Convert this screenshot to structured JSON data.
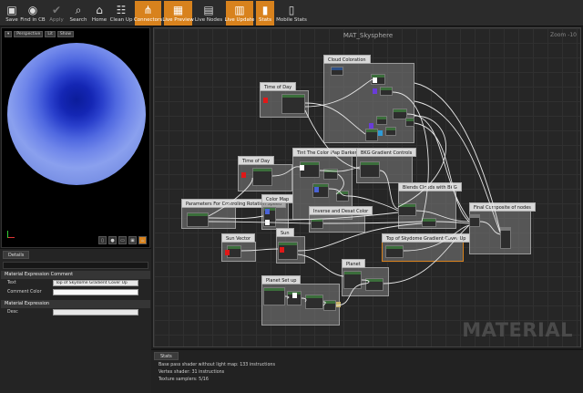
{
  "toolbar": {
    "buttons": [
      {
        "label": "Save",
        "icon": "save-icon"
      },
      {
        "label": "Find in CB",
        "icon": "find-icon"
      },
      {
        "label": "Apply",
        "icon": "apply-icon"
      },
      {
        "label": "Search",
        "icon": "search-icon"
      },
      {
        "label": "Home",
        "icon": "home-icon"
      },
      {
        "label": "Clean Up",
        "icon": "clean-up-icon"
      },
      {
        "label": "Connectors",
        "icon": "connectors-icon"
      },
      {
        "label": "Live Preview",
        "icon": "live-preview-icon"
      },
      {
        "label": "Live Nodes",
        "icon": "live-nodes-icon"
      },
      {
        "label": "Live Update",
        "icon": "live-update-icon"
      },
      {
        "label": "Stats",
        "icon": "stats-icon"
      },
      {
        "label": "Mobile Stats",
        "icon": "mobile-stats-icon"
      }
    ],
    "active_color": "#d8821d"
  },
  "viewport": {
    "mode": "Perspective",
    "view": "Lit",
    "show": "Show",
    "sphere_color": "#2a40cc"
  },
  "details": {
    "tab": "Details",
    "sections": [
      {
        "title": "Material Expression Comment",
        "props": [
          {
            "label": "Text",
            "value": "Top of Skydome Gradient Cover Up"
          },
          {
            "label": "Comment Color",
            "value": ""
          }
        ]
      },
      {
        "title": "Material Expression",
        "props": [
          {
            "label": "Desc",
            "value": ""
          }
        ]
      }
    ]
  },
  "graph": {
    "title": "MAT_Skysphere",
    "zoom": "Zoom -10",
    "watermark": "MATERIAL",
    "comments": [
      "Cloud Coloration",
      "Time of Day",
      "Tint The Color Map Darker",
      "BKG Gradient Controls",
      "Time of Day",
      "Parameters For Controling Rotation Speed",
      "Color Map",
      "Inverse and Desat Color",
      "Blends Clouds with BKG",
      "Final Composite of nodes",
      "Sun Vector",
      "Sun",
      "Top of Skydome Gradient Cover Up",
      "Planet",
      "Planet Set up"
    ]
  },
  "stats": {
    "tab": "Stats",
    "lines": [
      "Base pass shader without light map: 133 instructions",
      "Vertex shader: 31 instructions",
      "Texture samplers: 5/16"
    ]
  }
}
